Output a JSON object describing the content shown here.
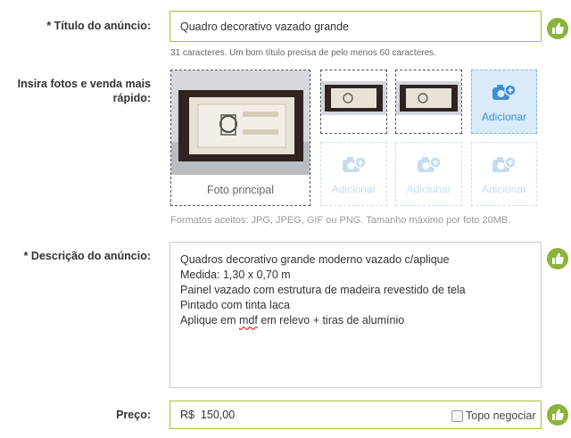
{
  "title_field": {
    "label": "* Título do anúncio:",
    "value": "Quadro decorativo vazado grande",
    "hint": "31 caracteres. Um bom título precisa de pelo menos 60 caracteres."
  },
  "photos": {
    "label_line1": "Insira fotos e venda mais",
    "label_line2": "rápido:",
    "main_caption": "Foto principal",
    "add_label": "Adicionar",
    "formats_hint": "Formatos aceitos: JPG, JPEG, GIF ou PNG. Tamanho máximo por foto 20MB.",
    "accent_color": "#3d8fd5"
  },
  "description_field": {
    "label": "* Descrição do anúncio:",
    "lines": [
      "Quadros decorativo grande moderno vazado c/aplique",
      "Medida: 1,30 x 0,70 m",
      "Painel vazado com estrutura de madeira revestido de tela",
      "Pintado com tinta laca"
    ],
    "last_line_prefix": "Aplique em ",
    "last_line_misspelled": "mdf",
    "last_line_suffix": " em relevo + tiras de alumínio"
  },
  "price_field": {
    "label": "Preço:",
    "value": "R$  150,00",
    "negotiate_label": "Topo negociar",
    "negotiate_checked": false
  },
  "status": {
    "ok_icon": "thumbs-up-icon",
    "ok_color": "#8cb43a"
  }
}
